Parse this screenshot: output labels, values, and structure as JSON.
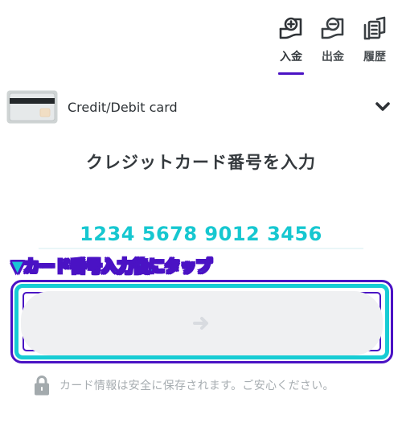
{
  "tabs": [
    {
      "label": "入金",
      "icon": "deposit-icon",
      "active": true
    },
    {
      "label": "出金",
      "icon": "withdraw-icon",
      "active": false
    },
    {
      "label": "履歴",
      "icon": "history-icon",
      "active": false
    }
  ],
  "payment_method": {
    "label": "Credit/Debit card",
    "icon": "credit-card-icon"
  },
  "heading": "クレジットカード番号を入力",
  "card_number": {
    "value": "1234 5678 9012 3456",
    "placeholder": ""
  },
  "annotation": "▼カード番号入力後にタップ",
  "submit": {
    "icon": "arrow-right-icon",
    "disabled": true
  },
  "security_note": "カード情報は安全に保存されます。ご安心ください。",
  "colors": {
    "accent": "#4b12c4",
    "input_text": "#16c7d0",
    "annotation_fill": "#19c5d5",
    "button_bg": "#eff0f2"
  }
}
